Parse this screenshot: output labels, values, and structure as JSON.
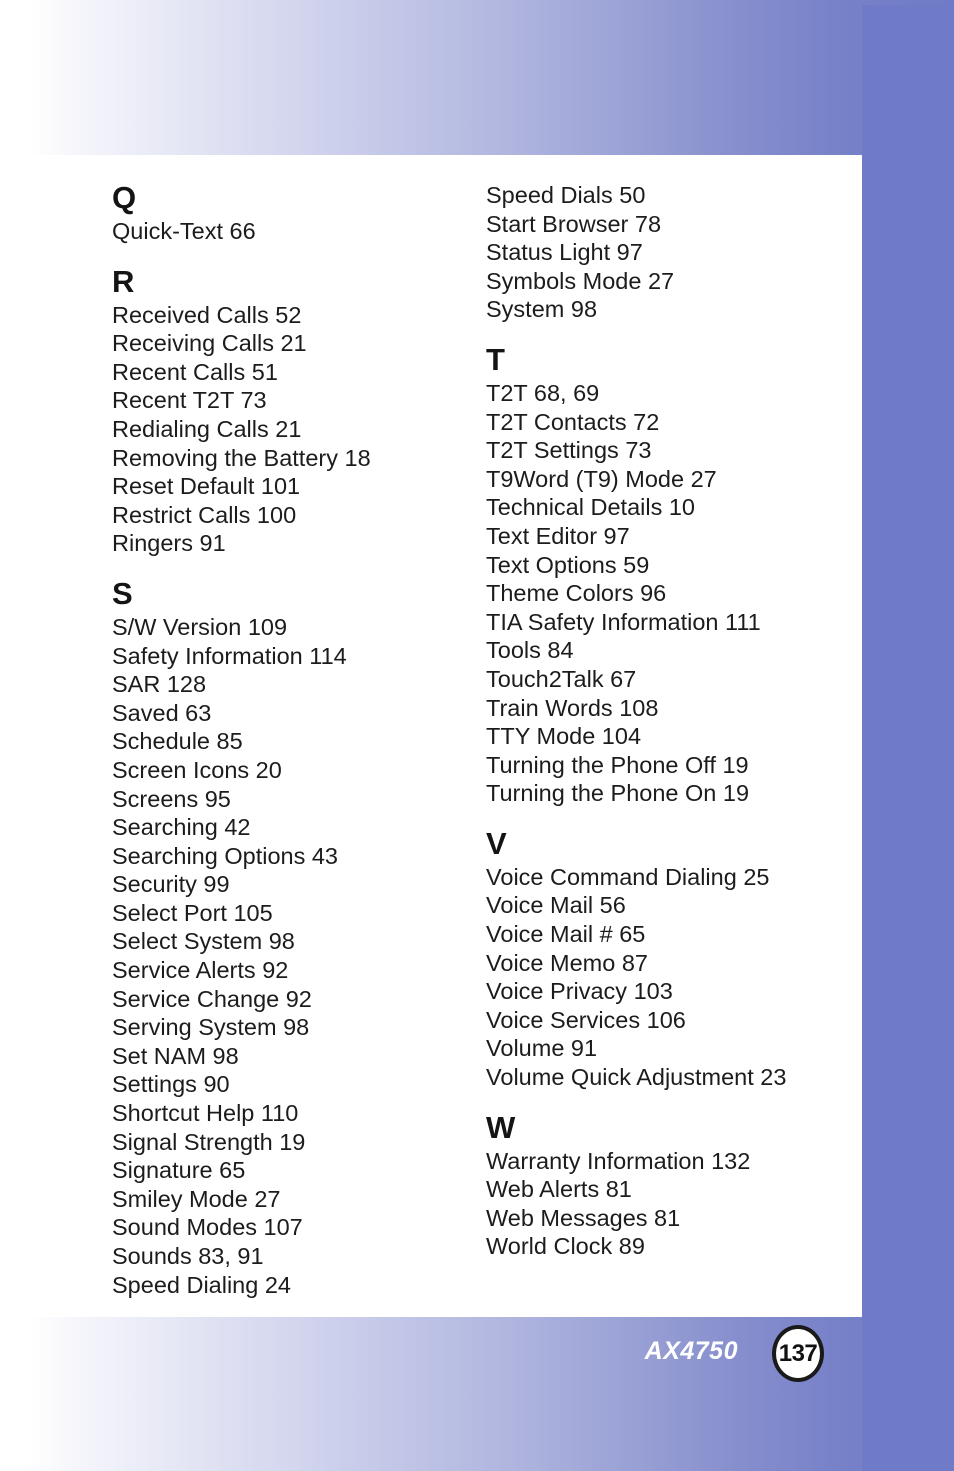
{
  "document": {
    "type": "index-page",
    "model_label": "AX4750",
    "page_number": "137"
  },
  "colors": {
    "background_start": "#ffffff",
    "background_end": "#6f7bc7",
    "panel": "#ffffff",
    "text": "#1c1c1c",
    "heading": "#141414",
    "footer_text": "#ffffff",
    "page_circle_border": "#1a1a1a"
  },
  "index": {
    "left_column": [
      {
        "letter": "Q",
        "entries": [
          "Quick-Text 66"
        ]
      },
      {
        "letter": "R",
        "entries": [
          "Received Calls 52",
          "Receiving Calls 21",
          "Recent Calls 51",
          "Recent T2T 73",
          "Redialing Calls 21",
          "Removing the Battery 18",
          "Reset Default 101",
          "Restrict Calls 100",
          "Ringers 91"
        ]
      },
      {
        "letter": "S",
        "entries": [
          "S/W Version 109",
          "Safety Information 114",
          "SAR 128",
          "Saved 63",
          "Schedule 85",
          "Screen Icons 20",
          "Screens 95",
          "Searching 42",
          "Searching Options 43",
          "Security 99",
          "Select Port 105",
          "Select System 98",
          "Service Alerts 92",
          "Service Change 92",
          "Serving System 98",
          "Set NAM 98",
          "Settings 90",
          "Shortcut Help 110",
          "Signal Strength 19",
          "Signature 65",
          "Smiley Mode 27",
          "Sound Modes 107",
          "Sounds 83, 91",
          "Speed Dialing 24"
        ]
      }
    ],
    "right_column": [
      {
        "letter": "",
        "entries": [
          "Speed Dials 50",
          "Start Browser 78",
          "Status Light 97",
          "Symbols Mode 27",
          "System 98"
        ]
      },
      {
        "letter": "T",
        "entries": [
          "T2T 68, 69",
          "T2T Contacts 72",
          "T2T Settings 73",
          "T9Word (T9) Mode 27",
          "Technical Details 10",
          "Text Editor 97",
          "Text Options 59",
          "Theme Colors 96",
          "TIA Safety Information 111",
          "Tools 84",
          "Touch2Talk 67",
          "Train Words 108",
          "TTY Mode 104",
          "Turning the Phone Off 19",
          "Turning the Phone On 19"
        ]
      },
      {
        "letter": "V",
        "entries": [
          "Voice Command Dialing 25",
          "Voice Mail 56",
          "Voice Mail # 65",
          "Voice Memo 87",
          "Voice Privacy 103",
          "Voice Services 106",
          "Volume 91",
          "Volume Quick Adjustment 23"
        ]
      },
      {
        "letter": "W",
        "entries": [
          "Warranty Information 132",
          "Web Alerts 81",
          "Web Messages 81",
          "World Clock 89"
        ]
      }
    ]
  }
}
